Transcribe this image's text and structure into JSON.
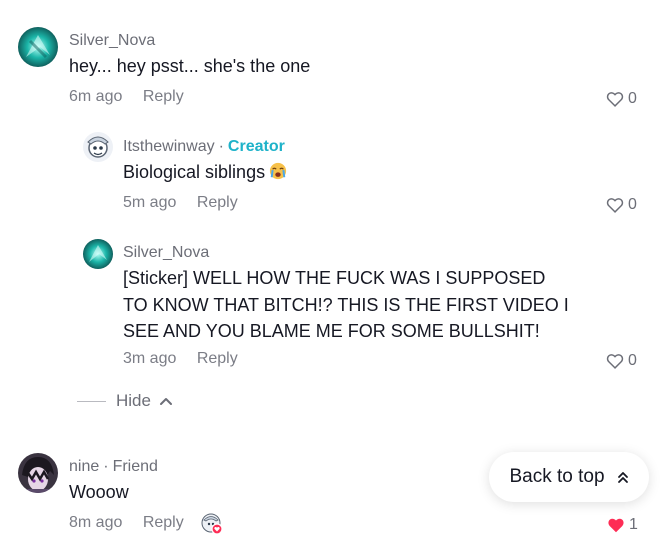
{
  "comments": [
    {
      "username": "Silver_Nova",
      "text": "hey... hey psst... she's the one",
      "time": "6m ago",
      "reply_label": "Reply",
      "likes": "0"
    },
    {
      "username": "Itsthewinway",
      "badge": "Creator",
      "separator": "·",
      "text": "Biological siblings",
      "emoji": "crying-face-emoji",
      "time": "5m ago",
      "reply_label": "Reply",
      "likes": "0"
    },
    {
      "username": "Silver_Nova",
      "text_lines": [
        "[Sticker] WELL HOW THE FUCK WAS I SUPPOSED",
        "TO KNOW THAT BITCH!? THIS IS THE FIRST VIDEO I",
        "SEE AND YOU BLAME ME FOR SOME BULLSHIT!"
      ],
      "time": "3m ago",
      "reply_label": "Reply",
      "likes": "0"
    },
    {
      "username": "nine",
      "badge": "Friend",
      "separator": "·",
      "text": "Wooow",
      "time": "8m ago",
      "reply_label": "Reply",
      "likes": "1",
      "liked": true
    }
  ],
  "hide_label": "Hide",
  "back_to_top_label": "Back to top",
  "colors": {
    "creator": "#1eb2c9",
    "like_active": "#fe2c55",
    "secondary_text": "#6c6e77"
  }
}
